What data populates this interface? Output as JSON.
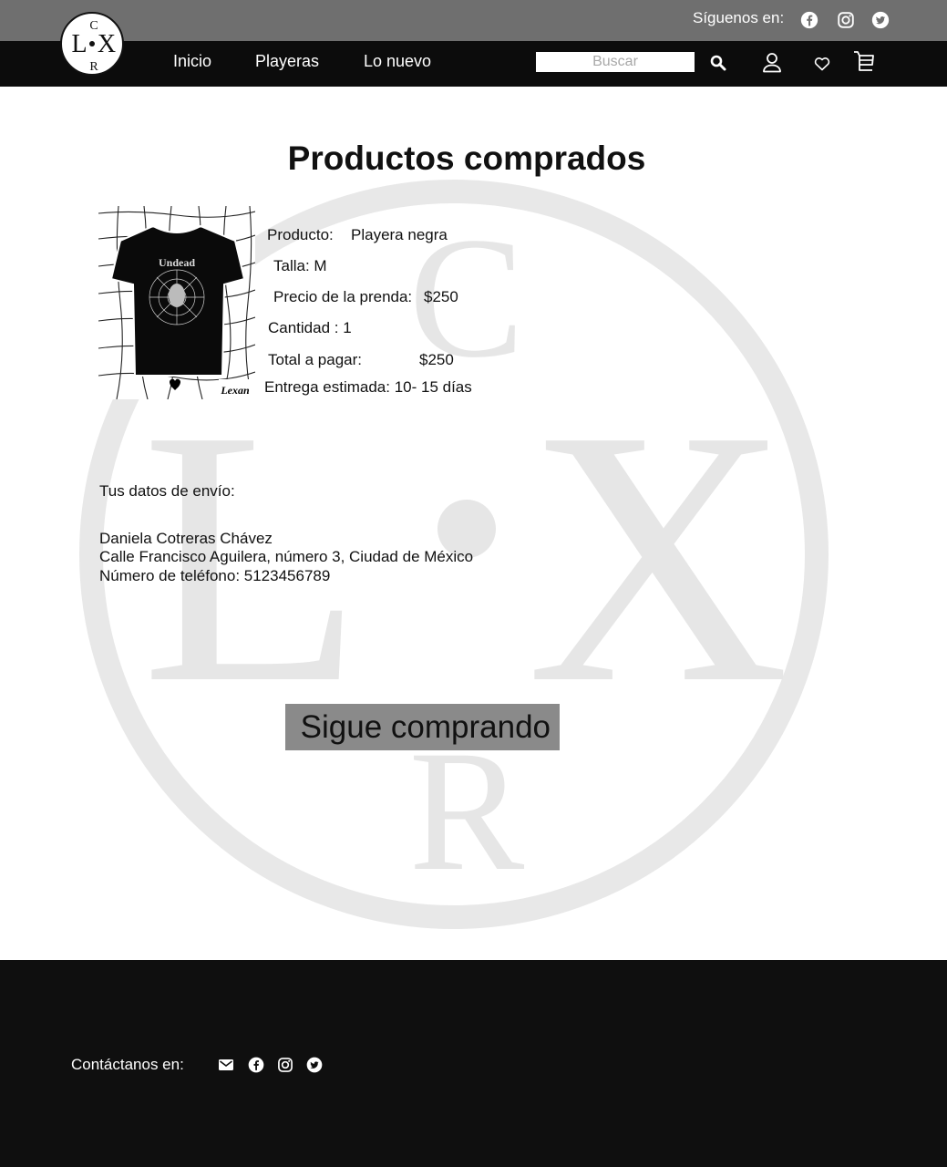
{
  "header": {
    "follow_label": "Síguenos en:",
    "social_icons": [
      "facebook-icon",
      "instagram-icon",
      "twitter-icon"
    ],
    "logo": {
      "letters": {
        "top": "C",
        "left": "L",
        "right": "X",
        "bottom": "R"
      }
    },
    "nav": [
      {
        "label": "Inicio"
      },
      {
        "label": "Playeras"
      },
      {
        "label": "Lo nuevo"
      }
    ],
    "search": {
      "placeholder": "Buscar",
      "value": ""
    },
    "icons": [
      "search-icon",
      "user-icon",
      "heart-icon",
      "cart-icon"
    ]
  },
  "main": {
    "title": "Productos comprados",
    "product": {
      "image_text": {
        "brand_on_shirt": "Undead",
        "label": "Lexan"
      },
      "name_label": "Producto:",
      "name_value": "Playera negra",
      "size": "Talla: M",
      "price_label": "Precio de la prenda:",
      "price_value": "$250",
      "quantity": "Cantidad : 1",
      "total_label": "Total a pagar:",
      "total_value": "$250",
      "delivery": "Entrega estimada: 10- 15 días"
    },
    "shipping": {
      "title": "Tus datos de envío:",
      "name": "Daniela Cotreras Chávez",
      "address": "Calle Francisco Aguilera, número 3, Ciudad de México",
      "phone": "Número de teléfono: 5123456789"
    },
    "continue_button": "Sigue comprando"
  },
  "footer": {
    "contact_label": "Contáctanos en:",
    "icons": [
      "mail-icon",
      "facebook-icon",
      "instagram-icon",
      "twitter-icon"
    ]
  },
  "colors": {
    "topbar": "#6f6f6f",
    "navbar": "#0c0c0c",
    "footer": "#0f0f0f",
    "button": "#8a8a8a",
    "watermark": "#e6e6e6"
  }
}
